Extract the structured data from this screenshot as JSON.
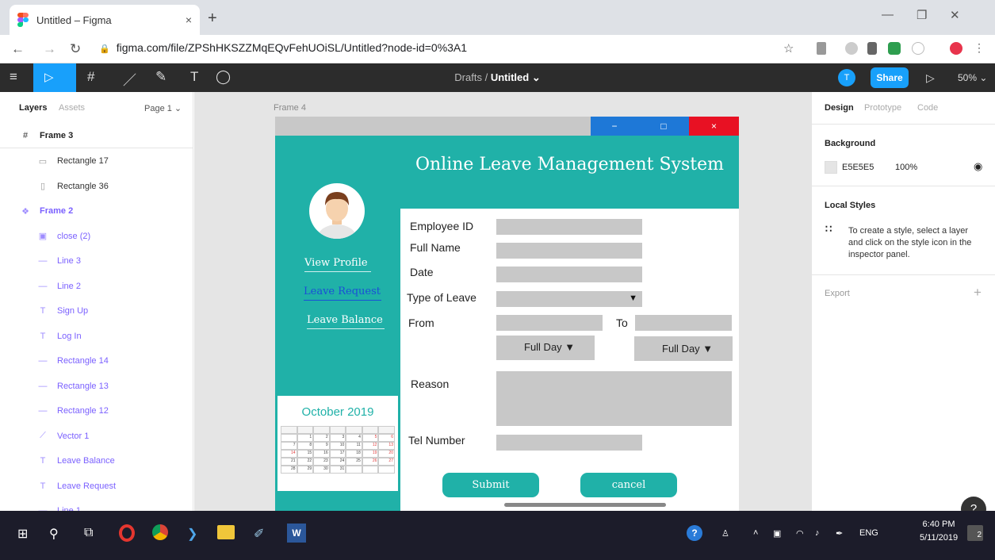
{
  "browser": {
    "tab_title": "Untitled – Figma",
    "tab_close": "×",
    "new_tab": "+",
    "url": "figma.com/file/ZPShHKSZZMqEQvFehUOiSL/Untitled?node-id=0%3A1"
  },
  "figma_toolbar": {
    "breadcrumb_parent": "Drafts",
    "breadcrumb_sep": "/",
    "breadcrumb_file": "Untitled ⌄",
    "user_initial": "T",
    "share_label": "Share",
    "zoom": "50% ⌄"
  },
  "left_panel": {
    "tab_layers": "Layers",
    "tab_assets": "Assets",
    "page_selector": "Page 1 ⌄",
    "layers": [
      {
        "label": "Frame 3",
        "icon": "#"
      },
      {
        "label": "Rectangle 17",
        "icon": "▭"
      },
      {
        "label": "Rectangle 36",
        "icon": "▯"
      },
      {
        "label": "Frame 2",
        "icon": "❖"
      },
      {
        "label": "close (2)",
        "icon": "▣"
      },
      {
        "label": "Line 3",
        "icon": "—"
      },
      {
        "label": "Line 2",
        "icon": "—"
      },
      {
        "label": "Sign Up",
        "icon": "T"
      },
      {
        "label": "Log In",
        "icon": "T"
      },
      {
        "label": "Rectangle 14",
        "icon": "—"
      },
      {
        "label": "Rectangle 13",
        "icon": "—"
      },
      {
        "label": "Rectangle 12",
        "icon": "—"
      },
      {
        "label": "Vector 1",
        "icon": "⟋"
      },
      {
        "label": "Leave Balance",
        "icon": "T"
      },
      {
        "label": "Leave Request",
        "icon": "T"
      },
      {
        "label": "Line 1",
        "icon": "—"
      }
    ]
  },
  "canvas": {
    "frame_label": "Frame 4",
    "window_buttons": {
      "minimize": "−",
      "maximize": "□",
      "close": "×"
    },
    "app_title": "Online Leave Management System",
    "nav": {
      "view_profile": "View Profile",
      "leave_request": "Leave Request",
      "leave_balance": "Leave Balance"
    },
    "calendar": {
      "title": "October 2019",
      "days": [
        "",
        "1",
        "2",
        "3",
        "4",
        "5",
        "6",
        "7",
        "8",
        "9",
        "10",
        "11",
        "12",
        "13",
        "14",
        "15",
        "16",
        "17",
        "18",
        "19",
        "20",
        "21",
        "22",
        "23",
        "24",
        "25",
        "26",
        "27",
        "28",
        "29",
        "30",
        "31",
        "",
        "",
        ""
      ]
    },
    "form": {
      "employee_id": "Employee ID",
      "full_name": "Full Name",
      "date": "Date",
      "type_of_leave": "Type of Leave",
      "from": "From",
      "to": "To",
      "full_day_1": "Full Day  ▼",
      "full_day_2": "Full Day  ▼",
      "dropdown_arrow": "▼",
      "reason": "Reason",
      "tel_number": "Tel Number",
      "submit": "Submit",
      "cancel": "cancel"
    }
  },
  "right_panel": {
    "tab_design": "Design",
    "tab_prototype": "Prototype",
    "tab_code": "Code",
    "background_heading": "Background",
    "bg_hex": "E5E5E5",
    "bg_opacity": "100%",
    "local_styles_heading": "Local Styles",
    "local_styles_hint": "To create a style, select a layer and click on the style icon in the inspector panel.",
    "export_heading": "Export",
    "export_add": "+",
    "help": "?"
  },
  "taskbar": {
    "language": "ENG",
    "time": "6:40 PM",
    "date": "5/11/2019",
    "notification_count": "2"
  },
  "colors": {
    "teal": "#20B1A8",
    "figma_blue": "#18A0FB",
    "canvas_bg": "#E5E5E5",
    "close_red": "#E81123"
  }
}
